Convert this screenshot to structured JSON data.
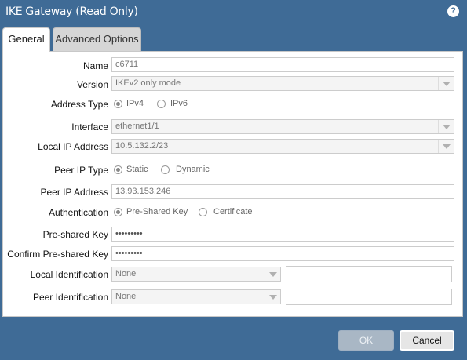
{
  "window": {
    "title": "IKE Gateway (Read Only)",
    "help_icon": "?"
  },
  "tabs": [
    {
      "label": "General",
      "active": true
    },
    {
      "label": "Advanced Options",
      "active": false
    }
  ],
  "form": {
    "name": {
      "label": "Name",
      "value": "c6711"
    },
    "version": {
      "label": "Version",
      "value": "IKEv2 only mode"
    },
    "address_type": {
      "label": "Address Type",
      "options": [
        "IPv4",
        "IPv6"
      ],
      "selected": "IPv4"
    },
    "interface": {
      "label": "Interface",
      "value": "ethernet1/1"
    },
    "local_ip": {
      "label": "Local IP Address",
      "value": "10.5.132.2/23"
    },
    "peer_ip_type": {
      "label": "Peer IP Type",
      "options": [
        "Static",
        "Dynamic"
      ],
      "selected": "Static"
    },
    "peer_ip": {
      "label": "Peer IP Address",
      "value": "13.93.153.246"
    },
    "authentication": {
      "label": "Authentication",
      "options": [
        "Pre-Shared Key",
        "Certificate"
      ],
      "selected": "Pre-Shared Key"
    },
    "psk": {
      "label": "Pre-shared Key",
      "value": "•••••••••"
    },
    "confirm_psk": {
      "label": "Confirm Pre-shared Key",
      "value": "•••••••••"
    },
    "local_id": {
      "label": "Local Identification",
      "type": "None",
      "value": ""
    },
    "peer_id": {
      "label": "Peer Identification",
      "type": "None",
      "value": ""
    }
  },
  "buttons": {
    "ok": "OK",
    "cancel": "Cancel"
  }
}
